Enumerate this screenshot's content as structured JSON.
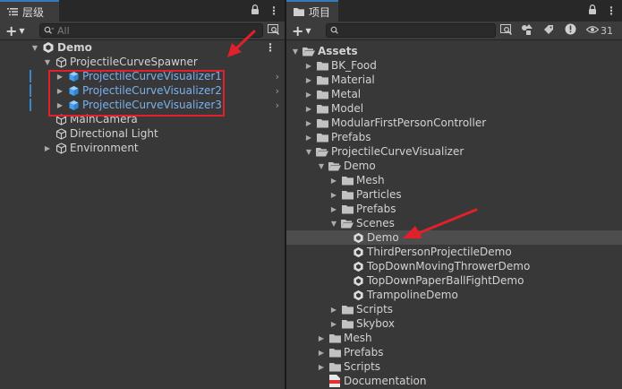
{
  "hierarchy": {
    "tab_title": "层级",
    "search_placeholder": "All",
    "scene": "Demo",
    "items": [
      {
        "label": "ProjectileCurveSpawner"
      },
      {
        "label": "ProjectileCurveVisualizer1"
      },
      {
        "label": "ProjectileCurveVisualizer2"
      },
      {
        "label": "ProjectileCurveVisualizer3"
      },
      {
        "label": "MainCamera"
      },
      {
        "label": "Directional Light"
      },
      {
        "label": "Environment"
      }
    ]
  },
  "project": {
    "tab_title": "项目",
    "visible_count": "31",
    "items": [
      {
        "label": "Assets"
      },
      {
        "label": "BK_Food"
      },
      {
        "label": "Material"
      },
      {
        "label": "Metal"
      },
      {
        "label": "Model"
      },
      {
        "label": "ModularFirstPersonController"
      },
      {
        "label": "Prefabs"
      },
      {
        "label": "ProjectileCurveVisualizer"
      },
      {
        "label": "Demo"
      },
      {
        "label": "Mesh"
      },
      {
        "label": "Particles"
      },
      {
        "label": "Prefabs"
      },
      {
        "label": "Scenes"
      },
      {
        "label": "Demo"
      },
      {
        "label": "ThirdPersonProjectileDemo"
      },
      {
        "label": "TopDownMovingThrowerDemo"
      },
      {
        "label": "TopDownPaperBallFightDemo"
      },
      {
        "label": "TrampolineDemo"
      },
      {
        "label": "Scripts"
      },
      {
        "label": "Skybox"
      },
      {
        "label": "Mesh"
      },
      {
        "label": "Prefabs"
      },
      {
        "label": "Scripts"
      },
      {
        "label": "Documentation"
      }
    ]
  },
  "colors": {
    "accent_tab": "#3a79bb",
    "selected_text": "#7ab0f0",
    "annotation_red": "#e0202a",
    "folder": "#c2c2c2"
  }
}
